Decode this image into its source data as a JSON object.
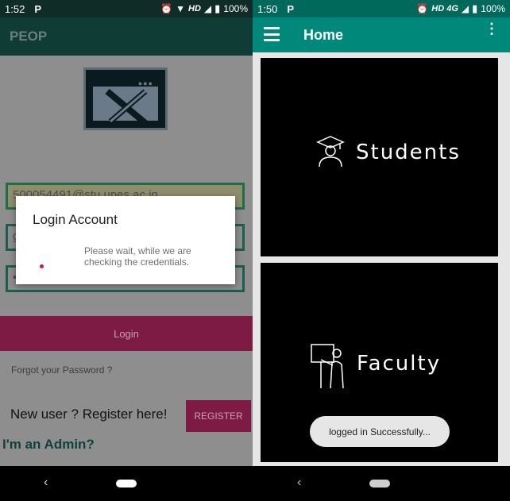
{
  "left": {
    "status": {
      "time": "1:52",
      "app_icon": "P",
      "network": "HD",
      "battery": "100%"
    },
    "appbar": {
      "title": "PEOP"
    },
    "logo_icon": "ruler-pencil-window-logo",
    "fields": {
      "email_value": "500054491@stu.upes.ac.in",
      "second_value": "g",
      "third_value": "•"
    },
    "login_button": "Login",
    "forgot_link": "Forgot your Password ?",
    "new_user_text": "New user ? Register here!",
    "register_button": "REGISTER",
    "admin_link": "I'm an Admin?",
    "dialog": {
      "title": "Login Account",
      "message": "Please wait, while we are checking the credentials."
    },
    "nav": {
      "back_icon": "‹"
    }
  },
  "right": {
    "status": {
      "time": "1:50",
      "app_icon": "P",
      "network": "HD 4G",
      "battery": "100%"
    },
    "appbar": {
      "title": "Home",
      "menu_icon": "hamburger-menu-icon",
      "more_icon": "⋮"
    },
    "tiles": [
      {
        "label": "Students",
        "icon": "graduate-icon"
      },
      {
        "label": "Faculty",
        "icon": "teacher-board-icon"
      }
    ],
    "toast": "logged in Successfully...",
    "nav": {
      "back_icon": "‹"
    }
  },
  "colors": {
    "left_appbar": "#0f3d36",
    "right_appbar": "#00897b",
    "accent": "#c2185b"
  }
}
